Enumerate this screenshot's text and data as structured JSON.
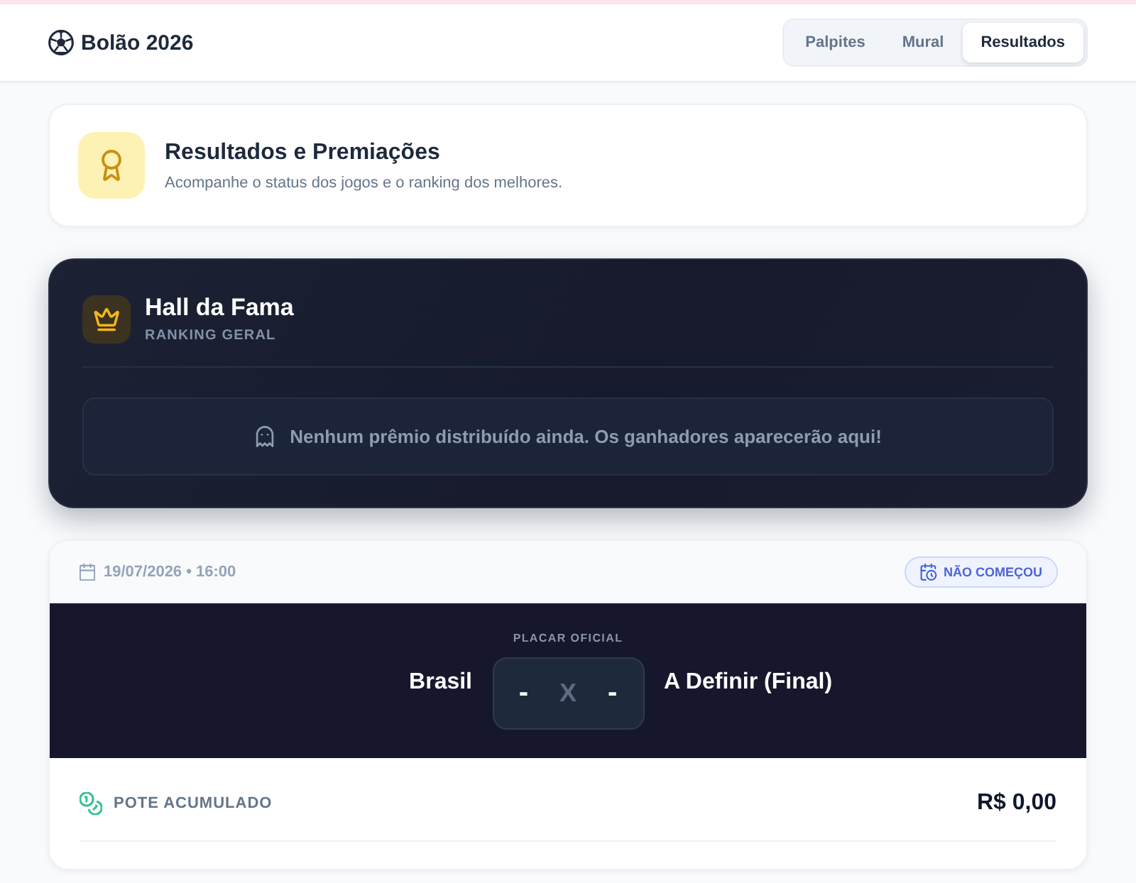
{
  "header": {
    "logo": "Bolão 2026",
    "tabs": [
      {
        "label": "Palpites",
        "selected": false
      },
      {
        "label": "Mural",
        "selected": false
      },
      {
        "label": "Resultados",
        "selected": true
      }
    ]
  },
  "page_header": {
    "title": "Resultados e Premiações",
    "subtitle": "Acompanhe o status dos jogos e o ranking dos melhores."
  },
  "hall_of_fame": {
    "title": "Hall da Fama",
    "subtitle": "RANKING GERAL",
    "empty_message": "Nenhum prêmio distribuído ainda. Os ganhadores aparecerão aqui!"
  },
  "match": {
    "datetime": "19/07/2026 • 16:00",
    "status": {
      "kind": "not_started",
      "label": "NÃO COMEÇOU"
    },
    "score_label": "PLACAR OFICIAL",
    "home_team": "Brasil",
    "home_score": "-",
    "separator": "X",
    "away_score": "-",
    "away_team": "A Definir (Final)",
    "pot_label": "POTE ACUMULADO",
    "pot_value": "R$ 0,00"
  }
}
